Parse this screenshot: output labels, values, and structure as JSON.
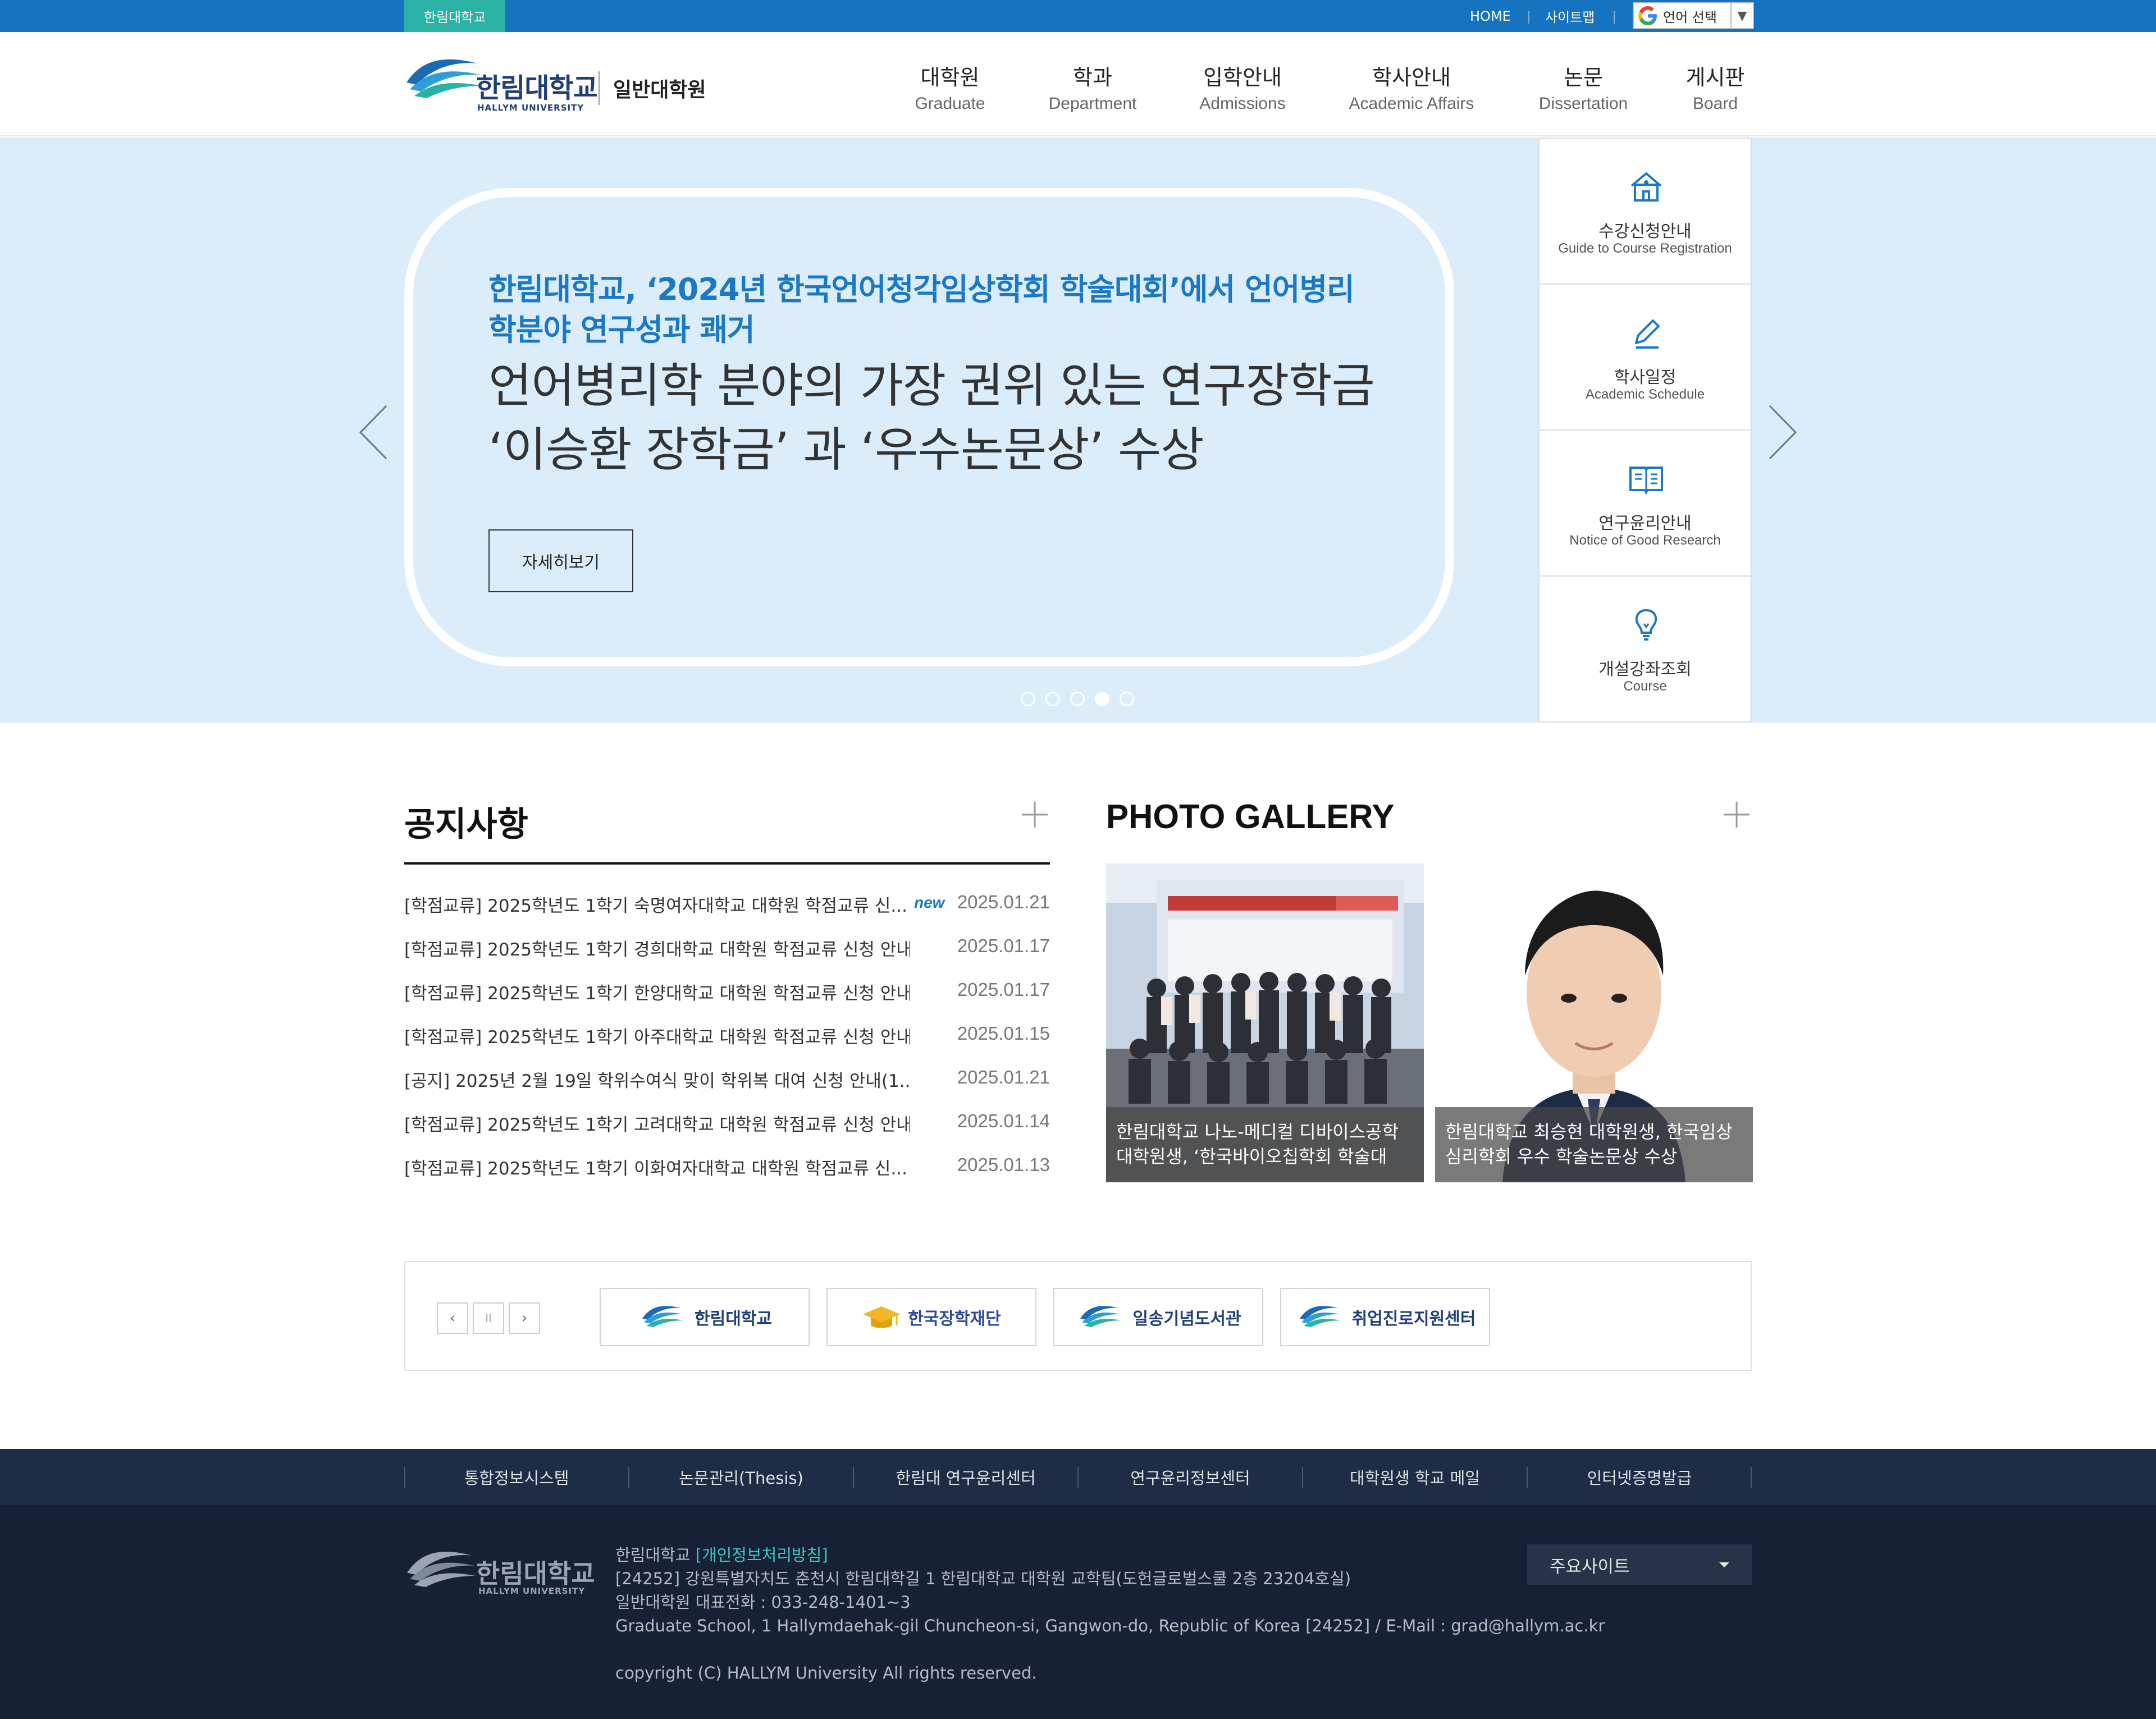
{
  "topbar": {
    "site_tab": "한림대학교",
    "home": "HOME",
    "sitemap": "사이트맵",
    "language_select": "언어 선택",
    "language_arrow": "▼"
  },
  "header": {
    "logo_ko": "한림대학교",
    "logo_en": "HALLYM UNIVERSITY",
    "school_name": "일반대학원",
    "nav": [
      {
        "ko": "대학원",
        "en": "Graduate"
      },
      {
        "ko": "학과",
        "en": "Department"
      },
      {
        "ko": "입학안내",
        "en": "Admissions"
      },
      {
        "ko": "학사안내",
        "en": "Academic Affairs"
      },
      {
        "ko": "논문",
        "en": "Dissertation"
      },
      {
        "ko": "게시판",
        "en": "Board"
      }
    ]
  },
  "hero": {
    "title": "한림대학교, ‘2024년 한국언어청각임상학회 학술대회’에서 언어병리학분야 연구성과 쾌거",
    "subtitle": "언어병리학 분야의 가장 권위 있는 연구장학금 ‘이승환 장학금’ 과 ‘우수논문상’ 수상",
    "button": "자세히보기",
    "slide_count": 5,
    "active_slide": 4
  },
  "quick_menu": [
    {
      "ko": "수강신청안내",
      "en": "Guide to Course Registration",
      "icon": "school-icon"
    },
    {
      "ko": "학사일정",
      "en": "Academic Schedule",
      "icon": "pencil-icon"
    },
    {
      "ko": "연구윤리안내",
      "en": "Notice of Good Research",
      "icon": "book-icon"
    },
    {
      "ko": "개설강좌조회",
      "en": "Course",
      "icon": "lightbulb-icon"
    }
  ],
  "notices": {
    "title": "공지사항",
    "items": [
      {
        "title": "[학점교류] 2025학년도 1학기 숙명여자대학교 대학원 학점교류 신...",
        "new": "new",
        "date": "2025.01.21"
      },
      {
        "title": "[학점교류] 2025학년도 1학기 경희대학교 대학원 학점교류 신청 안내",
        "new": "",
        "date": "2025.01.17"
      },
      {
        "title": "[학점교류] 2025학년도 1학기 한양대학교 대학원 학점교류 신청 안내",
        "new": "",
        "date": "2025.01.17"
      },
      {
        "title": "[학점교류] 2025학년도 1학기 아주대학교 대학원 학점교류 신청 안내",
        "new": "",
        "date": "2025.01.15"
      },
      {
        "title": "[공지] 2025년 2월 19일 학위수여식 맞이 학위복 대여 신청 안내(1....",
        "new": "",
        "date": "2025.01.21"
      },
      {
        "title": "[학점교류] 2025학년도 1학기 고려대학교 대학원 학점교류 신청 안내",
        "new": "",
        "date": "2025.01.14"
      },
      {
        "title": "[학점교류] 2025학년도 1학기 이화여자대학교 대학원 학점교류 신...",
        "new": "",
        "date": "2025.01.13"
      }
    ]
  },
  "gallery": {
    "title": "PHOTO GALLERY",
    "items": [
      {
        "caption": "한림대학교 나노-메디컬 디바이스공학 대학원생, ‘한국바이오칩학회 학술대"
      },
      {
        "caption": "한림대학교 최승현 대학원생, 한국임상심리학회 우수 학술논문상 수상"
      }
    ]
  },
  "partners": {
    "controls": {
      "prev": "‹",
      "pause": "II",
      "next": "›"
    },
    "items": [
      "한림대학교",
      "한국장학재단",
      "일송기념도서관",
      "취업진로지원센터"
    ]
  },
  "footer": {
    "links": [
      "통합정보시스템",
      "논문관리(Thesis)",
      "한림대 연구윤리센터",
      "연구윤리정보센터",
      "대학원생 학교 메일",
      "인터넷증명발급"
    ],
    "logo_ko": "한림대학교",
    "logo_en": "HALLYM UNIVERSITY",
    "org": "한림대학교",
    "privacy": "[개인정보처리방침]",
    "address": "[24252] 강원특별자치도 춘천시 한림대학길 1 한림대학교 대학원 교학팀(도헌글로벌스쿨 2층 23204호실)",
    "phone": "일반대학원 대표전화 : 033-248-1401~3",
    "address_en": "Graduate School, 1 Hallymdaehak-gil Chuncheon-si, Gangwon-do, Republic of Korea [24252]  /  E-Mail : grad@hallym.ac.kr",
    "copyright": "copyright (C) HALLYM University All rights reserved.",
    "family_site": "주요사이트"
  },
  "colors": {
    "topbar": "#1673c0",
    "accent_teal": "#2ab2a4",
    "hero_bg": "#dbedfb",
    "hero_title": "#1a78c5",
    "footer_dark": "#172135"
  }
}
